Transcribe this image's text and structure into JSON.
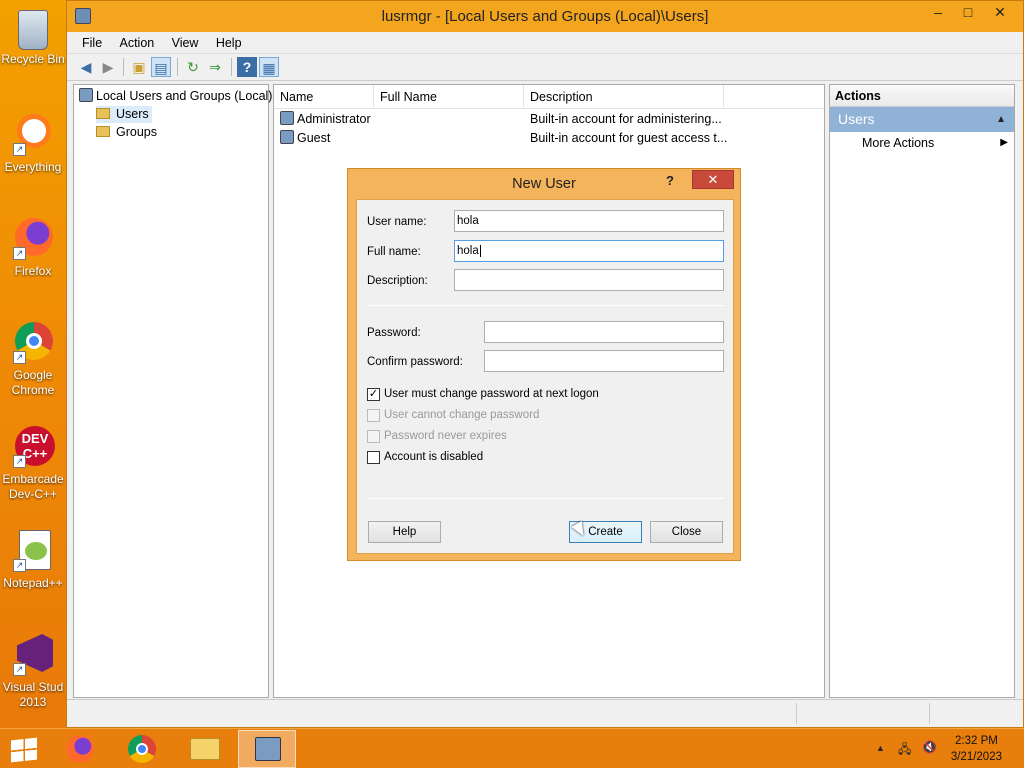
{
  "desktop": {
    "icons": [
      {
        "label": "Recycle Bin",
        "glyph": "🗑"
      },
      {
        "label": "Everything",
        "glyph": "⚲"
      },
      {
        "label": "Firefox",
        "glyph": "🦊"
      },
      {
        "label": "Google Chrome",
        "line1": "Google",
        "line2": "Chrome"
      },
      {
        "label": "Embarcadero Dev-C++",
        "line1": "Embarcade",
        "line2": "Dev-C++"
      },
      {
        "label": "Notepad++",
        "glyph": "📝"
      },
      {
        "label": "Visual Studio 2013",
        "line1": "Visual Stud",
        "line2": "2013"
      }
    ]
  },
  "window": {
    "title": "lusrmgr - [Local Users and Groups (Local)\\Users]",
    "minimize": "–",
    "maximize": "□",
    "close": "✕"
  },
  "menu": {
    "file": "File",
    "action": "Action",
    "view": "View",
    "help": "Help"
  },
  "tree": {
    "root": "Local Users and Groups (Local)",
    "users": "Users",
    "groups": "Groups"
  },
  "list": {
    "columns": {
      "name": "Name",
      "full_name": "Full Name",
      "description": "Description"
    },
    "rows": [
      {
        "name": "Administrator",
        "full_name": "",
        "description": "Built-in account for administering..."
      },
      {
        "name": "Guest",
        "full_name": "",
        "description": "Built-in account for guest access t..."
      }
    ]
  },
  "actions": {
    "header": "Actions",
    "section": "Users",
    "more": "More Actions"
  },
  "dialog": {
    "title": "New User",
    "help_glyph": "?",
    "close_glyph": "✕",
    "labels": {
      "username": "User name:",
      "fullname": "Full name:",
      "description": "Description:",
      "password": "Password:",
      "confirm": "Confirm password:"
    },
    "values": {
      "username": "hola",
      "fullname": "hola",
      "description": "",
      "password": "",
      "confirm": ""
    },
    "checkboxes": {
      "must_change": {
        "label": "User must change password at next logon",
        "checked": true
      },
      "cannot_change": {
        "label": "User cannot change password",
        "checked": false
      },
      "never_expires": {
        "label": "Password never expires",
        "checked": false
      },
      "disabled": {
        "label": "Account is disabled",
        "checked": false
      }
    },
    "buttons": {
      "help": "Help",
      "create": "Create",
      "close": "Close"
    }
  },
  "taskbar": {
    "time": "2:32 PM",
    "date": "3/21/2023"
  },
  "colors": {
    "desktop": "#f0900a",
    "window_frame": "#f4a51e",
    "dialog_frame": "#f4b45b",
    "selection": "#8fb2d6",
    "close_button": "#c74a3a"
  }
}
